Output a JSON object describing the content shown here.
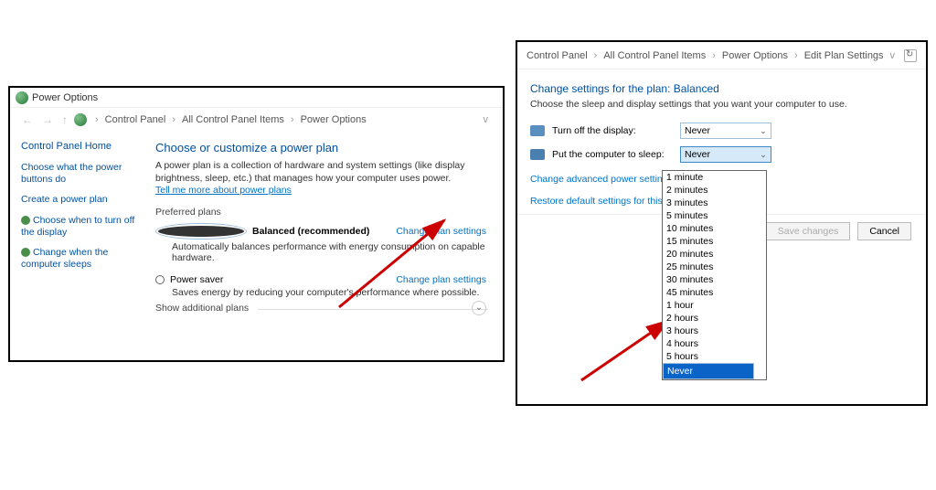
{
  "left": {
    "title": "Power Options",
    "breadcrumb": [
      "Control Panel",
      "All Control Panel Items",
      "Power Options"
    ],
    "sidebar": {
      "home": "Control Panel Home",
      "btns": "Choose what the power buttons do",
      "create": "Create a power plan",
      "turnoff": "Choose when to turn off the display",
      "sleeps": "Change when the computer sleeps"
    },
    "main": {
      "heading": "Choose or customize a power plan",
      "desc": "A power plan is a collection of hardware and system settings (like display brightness, sleep, etc.) that manages how your computer uses power. ",
      "desc_link": "Tell me more about power plans",
      "preferred": "Preferred plans",
      "plans": [
        {
          "name": "Balanced (recommended)",
          "desc": "Automatically balances performance with energy consumption on capable hardware.",
          "link": "Change plan settings",
          "selected": true
        },
        {
          "name": "Power saver",
          "desc": "Saves energy by reducing your computer's performance where possible.",
          "link": "Change plan settings",
          "selected": false
        }
      ],
      "additional": "Show additional plans"
    }
  },
  "right": {
    "breadcrumb": [
      "Control Panel",
      "All Control Panel Items",
      "Power Options",
      "Edit Plan Settings"
    ],
    "heading": "Change settings for the plan: Balanced",
    "sub": "Choose the sleep and display settings that you want your computer to use.",
    "display_label": "Turn off the display:",
    "display_value": "Never",
    "sleep_label": "Put the computer to sleep:",
    "sleep_value": "Never",
    "adv_link": "Change advanced power settings",
    "restore_link": "Restore default settings for this plan",
    "save_btn": "Save changes",
    "cancel_btn": "Cancel",
    "options": [
      "1 minute",
      "2 minutes",
      "3 minutes",
      "5 minutes",
      "10 minutes",
      "15 minutes",
      "20 minutes",
      "25 minutes",
      "30 minutes",
      "45 minutes",
      "1 hour",
      "2 hours",
      "3 hours",
      "4 hours",
      "5 hours",
      "Never"
    ]
  }
}
